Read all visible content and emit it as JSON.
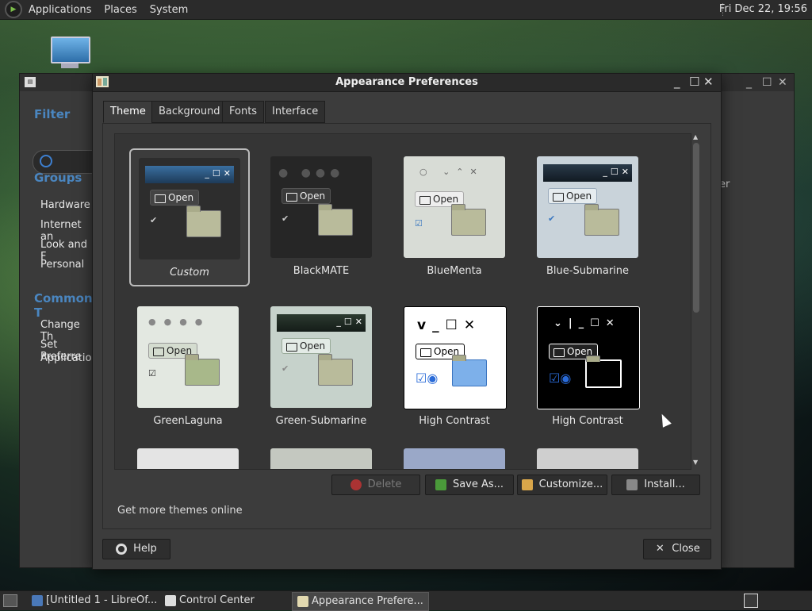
{
  "top_panel": {
    "menus": [
      "Applications",
      "Places",
      "System"
    ],
    "clock": "Fri Dec 22, 19:56"
  },
  "control_center": {
    "filter_label": "Filter",
    "groups_label": "Groups",
    "groups": [
      "Hardware",
      "Internet an",
      "Look and F",
      "Personal"
    ],
    "common_label": "Common T",
    "common_tasks": [
      "Change Th",
      "Set Preferre",
      "Application"
    ],
    "right_text": "er"
  },
  "dialog": {
    "title": "Appearance Preferences",
    "tabs": [
      "Theme",
      "Background",
      "Fonts",
      "Interface"
    ],
    "active_tab": "Theme",
    "themes": [
      {
        "name": "Custom",
        "selected": true
      },
      {
        "name": "BlackMATE"
      },
      {
        "name": "BlueMenta"
      },
      {
        "name": "Blue-Submarine"
      },
      {
        "name": "GreenLaguna"
      },
      {
        "name": "Green-Submarine"
      },
      {
        "name": "High Contrast"
      },
      {
        "name": "High Contrast"
      }
    ],
    "thumb_open_label": "Open",
    "buttons": {
      "delete": "Delete",
      "save_as": "Save As...",
      "customize": "Customize...",
      "install": "Install..."
    },
    "get_more_link": "Get more themes online",
    "help": "Help",
    "close": "Close"
  },
  "taskbar": {
    "tasks": [
      "[Untitled 1 - LibreOf...",
      "Control Center",
      "Appearance Prefere..."
    ],
    "active_task": "Appearance Prefere..."
  },
  "colors": {
    "accent_blue": "#4a86c0",
    "window_bg": "#3c3c3c",
    "titlebar_bg": "#2a2a2a"
  }
}
